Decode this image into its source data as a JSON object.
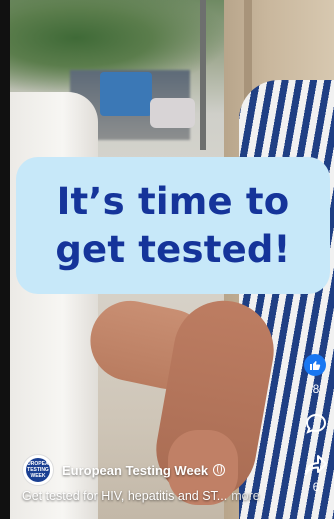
{
  "headline": {
    "line1": "It’s time to",
    "line2": "get tested!"
  },
  "actions": {
    "like_count": "8",
    "share_count": "6",
    "like_icon": "thumbs-up-icon",
    "comment_icon": "comment-icon",
    "share_icon": "share-arrow-icon"
  },
  "page": {
    "name": "European Testing Week",
    "avatar_text": "EUROPEAN TESTING WEEK",
    "privacy_icon": "globe-icon"
  },
  "caption": {
    "text": "Get tested for HIV, hepatitis and ST...",
    "more_label": "more"
  },
  "colors": {
    "headline_bg": "#c7e8f9",
    "headline_text": "#15349a",
    "like_blue": "#1877f2"
  }
}
